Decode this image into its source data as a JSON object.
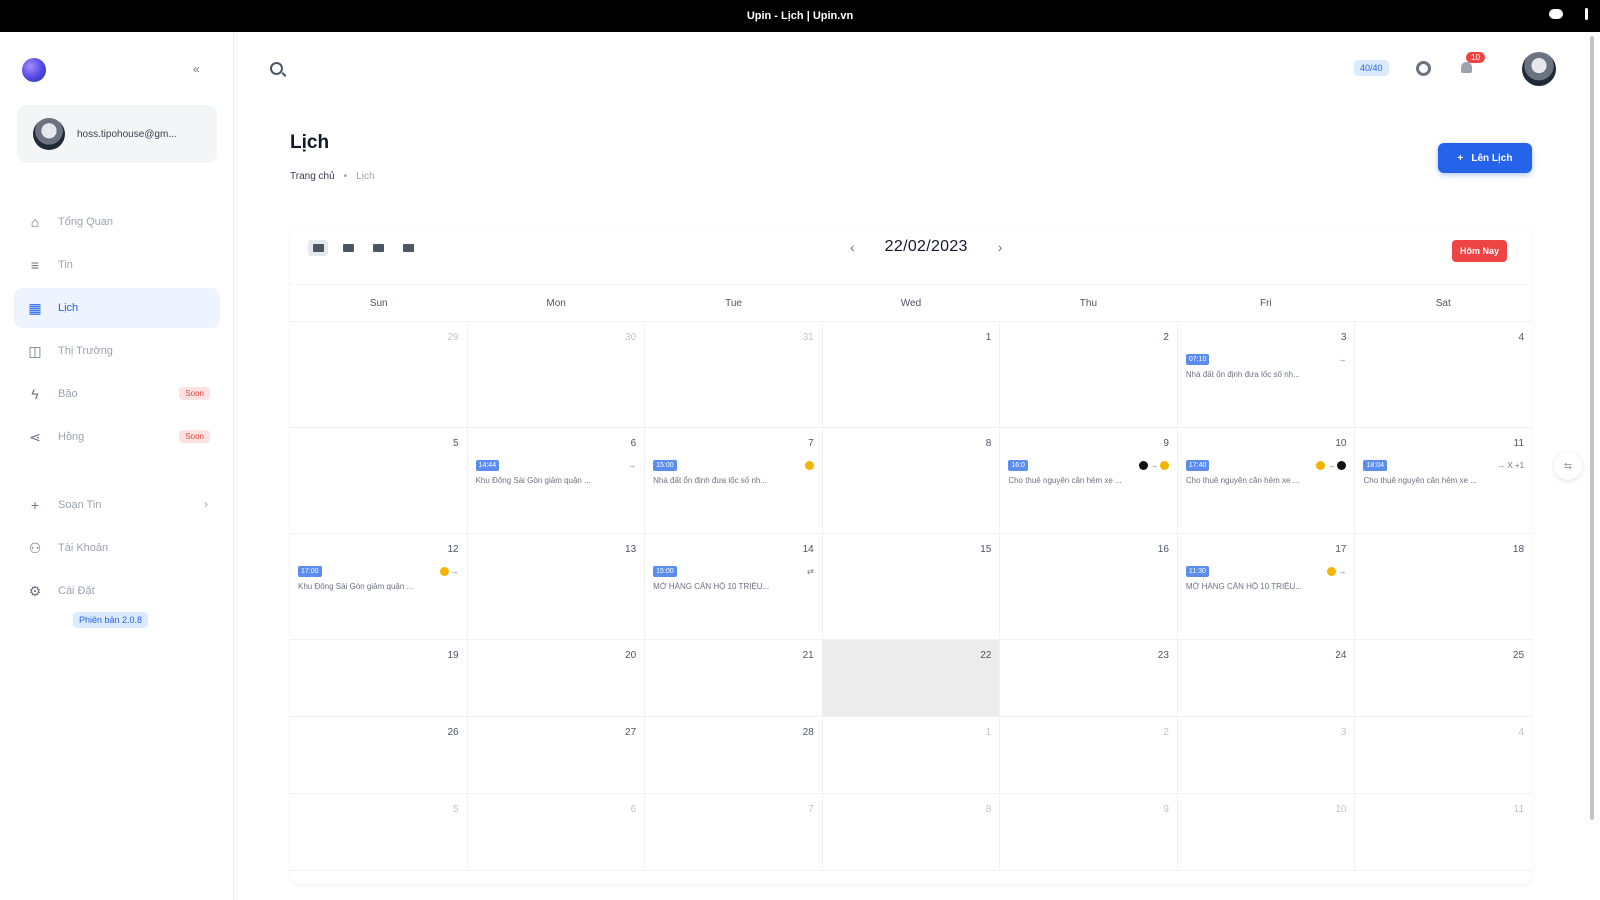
{
  "window": {
    "title": "Upin - Lịch | Upin.vn"
  },
  "sidebar": {
    "account_email": "hoss.tipohouse@gm...",
    "items": [
      {
        "label": "Tổng Quan",
        "icon": "home-icon",
        "active": false,
        "badge": ""
      },
      {
        "label": "Tin",
        "icon": "list-icon",
        "active": false,
        "badge": ""
      },
      {
        "label": "Lịch",
        "icon": "calendar-icon",
        "active": true,
        "badge": ""
      },
      {
        "label": "Thị Trường",
        "icon": "chart-icon",
        "active": false,
        "badge": ""
      },
      {
        "label": "Bão",
        "icon": "bolt-icon",
        "active": false,
        "badge": "Soon"
      },
      {
        "label": "Hồng",
        "icon": "share-icon",
        "active": false,
        "badge": "Soon"
      },
      {
        "label": "Soạn Tin",
        "icon": "plus-icon",
        "active": false,
        "badge": ""
      },
      {
        "label": "Tài Khoản",
        "icon": "users-icon",
        "active": false,
        "badge": ""
      },
      {
        "label": "Cài Đặt",
        "icon": "gear-icon",
        "active": false,
        "badge": ""
      }
    ],
    "version": "Phiên bản 2.0.8"
  },
  "header": {
    "credits": "40/40",
    "notification_count": "10"
  },
  "page": {
    "title": "Lịch",
    "breadcrumb": [
      "Trang chủ",
      "Lịch"
    ],
    "create_button": "Lên Lịch"
  },
  "calendar": {
    "current_date": "22/02/2023",
    "today_button": "Hôm Nay",
    "weekdays": [
      "Sun",
      "Mon",
      "Tue",
      "Wed",
      "Thu",
      "Fri",
      "Sat"
    ],
    "weeks": [
      [
        {
          "day": "29",
          "other": true
        },
        {
          "day": "30",
          "other": true
        },
        {
          "day": "31",
          "other": true
        },
        {
          "day": "1"
        },
        {
          "day": "2"
        },
        {
          "day": "3",
          "event": {
            "time": "07:10",
            "icons": "→",
            "title": "Nhà đất ổn định đưa lốc số nh..."
          }
        },
        {
          "day": "4"
        }
      ],
      [
        {
          "day": "5"
        },
        {
          "day": "6",
          "event": {
            "time": "14:44",
            "icons": "→",
            "title": "Khu Đông Sài Gòn giảm quận ..."
          }
        },
        {
          "day": "7",
          "event": {
            "time": "15:00",
            "icons": "●",
            "title": "Nhà đất ổn định đưa lốc số nh..."
          }
        },
        {
          "day": "8"
        },
        {
          "day": "9",
          "event": {
            "time": "16:0",
            "icons": "●→●",
            "title": "Cho thuê nguyên căn hẻm xe ..."
          }
        },
        {
          "day": "10",
          "event": {
            "time": "17:40",
            "icons": "●→●",
            "title": "Cho thuê nguyên căn hẻm xe ..."
          }
        },
        {
          "day": "11",
          "event": {
            "time": "18:04",
            "icons": "→ X +1",
            "title": "Cho thuê nguyên căn hẻm xe ..."
          }
        }
      ],
      [
        {
          "day": "12",
          "event": {
            "time": "17:00",
            "icons": "●→",
            "title": "Khu Đông Sài Gòn giảm quận ..."
          }
        },
        {
          "day": "13"
        },
        {
          "day": "14",
          "event": {
            "time": "15:00",
            "icons": "⇄",
            "title": "MỞ HÀNG CĂN HỘ 10 TRIỆU..."
          }
        },
        {
          "day": "15"
        },
        {
          "day": "16"
        },
        {
          "day": "17",
          "event": {
            "time": "11:30",
            "icons": "●→",
            "title": "MỞ HÀNG CĂN HỘ 10 TRIỆU..."
          }
        },
        {
          "day": "18"
        }
      ],
      [
        {
          "day": "19"
        },
        {
          "day": "20"
        },
        {
          "day": "21"
        },
        {
          "day": "22",
          "today": true
        },
        {
          "day": "23"
        },
        {
          "day": "24"
        },
        {
          "day": "25"
        }
      ],
      [
        {
          "day": "26"
        },
        {
          "day": "27"
        },
        {
          "day": "28"
        },
        {
          "day": "1",
          "other": true
        },
        {
          "day": "2",
          "other": true
        },
        {
          "day": "3",
          "other": true
        },
        {
          "day": "4",
          "other": true
        }
      ],
      [
        {
          "day": "5",
          "other": true
        },
        {
          "day": "6",
          "other": true
        },
        {
          "day": "7",
          "other": true
        },
        {
          "day": "8",
          "other": true
        },
        {
          "day": "9",
          "other": true
        },
        {
          "day": "10",
          "other": true
        },
        {
          "day": "11",
          "other": true
        }
      ]
    ]
  },
  "colors": {
    "accent": "#2563eb",
    "danger": "#ef4444",
    "event_time_bg": "#5b8def",
    "today_bg": "#ececec"
  }
}
